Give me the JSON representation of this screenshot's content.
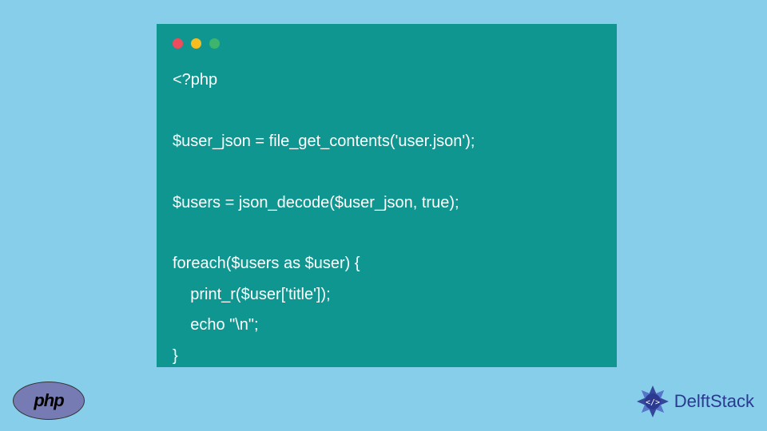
{
  "code": {
    "line1": "<?php",
    "line2": "",
    "line3": "$user_json = file_get_contents('user.json');",
    "line4": "",
    "line5": "$users = json_decode($user_json, true);",
    "line6": "",
    "line7": "foreach($users as $user) {",
    "line8": "    print_r($user['title']);",
    "line9": "    echo \"\\n\";",
    "line10": "}"
  },
  "php_logo": {
    "text": "php"
  },
  "delftstack": {
    "text": "DelftStack"
  }
}
